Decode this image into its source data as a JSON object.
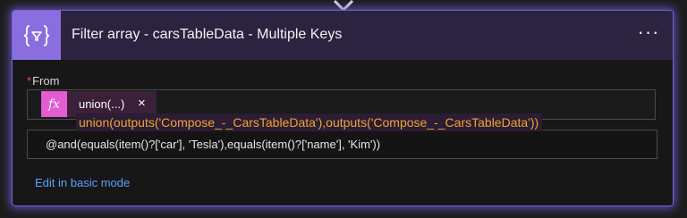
{
  "card": {
    "title": "Filter array - carsTableData - Multiple Keys",
    "icon": "filter-array-braces-icon",
    "more_icon": "ellipsis-icon",
    "more_label": "···"
  },
  "from": {
    "label": "From",
    "required_mark": "*",
    "token": {
      "icon": "function-fx-icon",
      "icon_text": "fx",
      "label": "union(...)",
      "close": "×",
      "tooltip": "union(outputs('Compose_-_CarsTableData'),outputs('Compose_-_CarsTableData'))"
    }
  },
  "condition": {
    "expression": "@and(equals(item()?['car'], 'Tesla'),equals(item()?['name'], 'Kim'))"
  },
  "link": {
    "edit_basic_mode": "Edit in basic mode"
  },
  "colors": {
    "header_bg": "#2b2340",
    "icon_bg": "#8a6ee0",
    "token_icon_bg": "#e35cd2",
    "tooltip_text": "#f3a32e",
    "link": "#5aa0ff",
    "glow": "#7a6ad8"
  }
}
